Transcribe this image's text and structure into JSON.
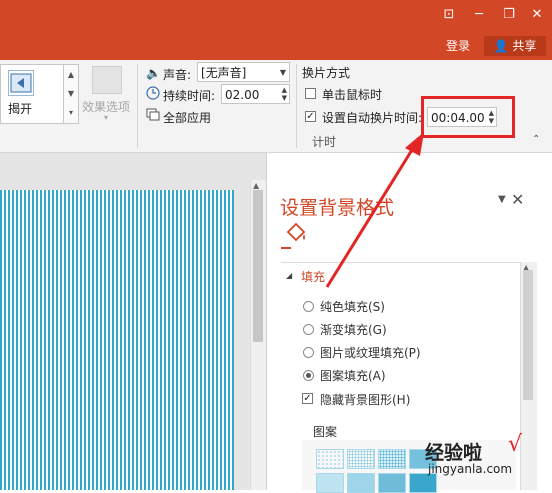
{
  "titlebar": {
    "restore_icon": "ribbon-display-icon",
    "login": "登录",
    "share": "共享"
  },
  "ribbon": {
    "transition_label": "揭开",
    "effect_options": "效果选项",
    "sound_label": "声音:",
    "sound_value": "[无声音]",
    "duration_label": "持续时间:",
    "duration_value": "02.00",
    "apply_all": "全部应用",
    "advance_title": "换片方式",
    "on_click": "单击鼠标时",
    "auto_after": "设置自动换片时间:",
    "auto_after_value": "00:04.00",
    "timing_group": "计时",
    "on_click_checked": false,
    "auto_after_checked": true
  },
  "pane": {
    "title": "设置背景格式",
    "fill_section": "填充",
    "options": [
      {
        "label": "纯色填充(S)",
        "selected": false
      },
      {
        "label": "渐变填充(G)",
        "selected": false
      },
      {
        "label": "图片或纹理填充(P)",
        "selected": false
      },
      {
        "label": "图案填充(A)",
        "selected": true
      }
    ],
    "hide_bg": "隐藏背景图形(H)",
    "hide_bg_checked": true,
    "pattern_label": "图案"
  },
  "watermark": {
    "brand": "经验啦",
    "check": "√",
    "url": "jingyanla.com"
  },
  "colors": {
    "accent": "#d24726",
    "highlight": "#e32525",
    "stripe": "#30a9c9"
  }
}
